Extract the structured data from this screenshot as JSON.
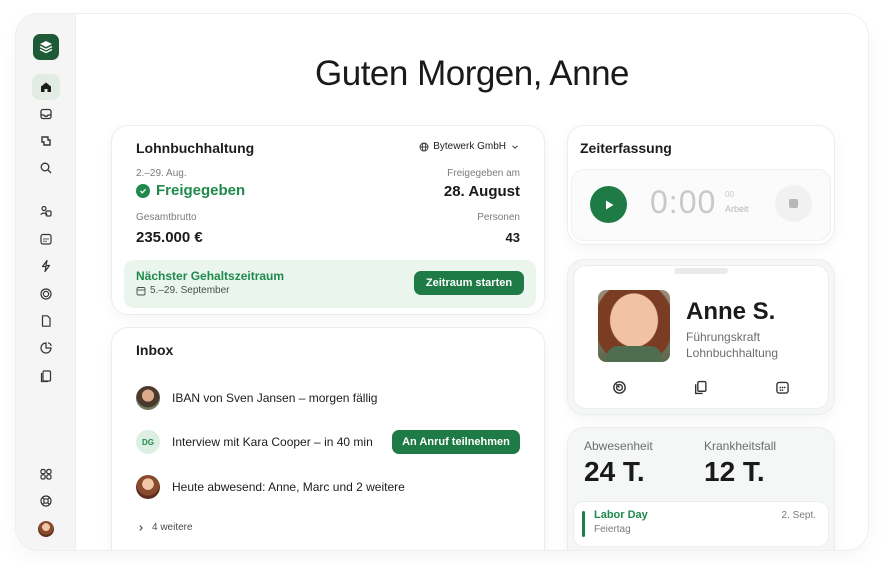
{
  "greeting": "Guten Morgen, Anne",
  "sidebar": {
    "items": [
      {
        "icon": "home-icon",
        "active": true
      },
      {
        "icon": "inbox-icon",
        "active": false
      },
      {
        "icon": "time-icon",
        "active": false
      },
      {
        "icon": "search-icon",
        "active": false
      },
      {
        "icon": "people-icon",
        "active": false
      },
      {
        "icon": "calendar-icon",
        "active": false
      },
      {
        "icon": "flash-icon",
        "active": false
      },
      {
        "icon": "target-icon",
        "active": false
      },
      {
        "icon": "document-icon",
        "active": false
      },
      {
        "icon": "chart-icon",
        "active": false
      },
      {
        "icon": "files-icon",
        "active": false
      },
      {
        "icon": "apps-icon",
        "active": false
      },
      {
        "icon": "help-icon",
        "active": false
      }
    ]
  },
  "payroll": {
    "title": "Lohnbuchhaltung",
    "company": "Bytewerk GmbH",
    "period": "2.–29. Aug.",
    "status": "Freigegeben",
    "released_label": "Freigegeben am",
    "released_date": "28. August",
    "gross_label": "Gesamtbrutto",
    "gross_value": "235.000 €",
    "people_label": "Personen",
    "people_value": "43",
    "next_title": "Nächster Gehaltszeitraum",
    "next_dates": "5.–29. September",
    "start_button": "Zeitraum starten"
  },
  "inbox": {
    "title": "Inbox",
    "items": [
      {
        "avatar": "",
        "text": "IBAN von Sven Jansen – morgen fällig"
      },
      {
        "avatar": "DG",
        "text": "Interview mit Kara Cooper – in 40 min",
        "action": "An Anruf teilnehmen"
      },
      {
        "avatar": "",
        "text": "Heute abwesend: Anne, Marc und 2 weitere"
      }
    ],
    "more": "4 weitere"
  },
  "time_tracking": {
    "title": "Zeiterfassung",
    "clock": "0:00",
    "seconds": "00",
    "label": "Arbeit"
  },
  "profile": {
    "name": "Anne S.",
    "role": "Führungskraft",
    "department": "Lohnbuchhaltung"
  },
  "absence": {
    "absence_label": "Abwesenheit",
    "absence_value": "24 T.",
    "sick_label": "Krankheitsfall",
    "sick_value": "12 T.",
    "holiday": {
      "name": "Labor Day",
      "type": "Feiertag",
      "date": "2. Sept."
    }
  },
  "colors": {
    "accent": "#1e7b45",
    "accent_text": "#1f8a4c",
    "logo": "#1e5a36"
  }
}
